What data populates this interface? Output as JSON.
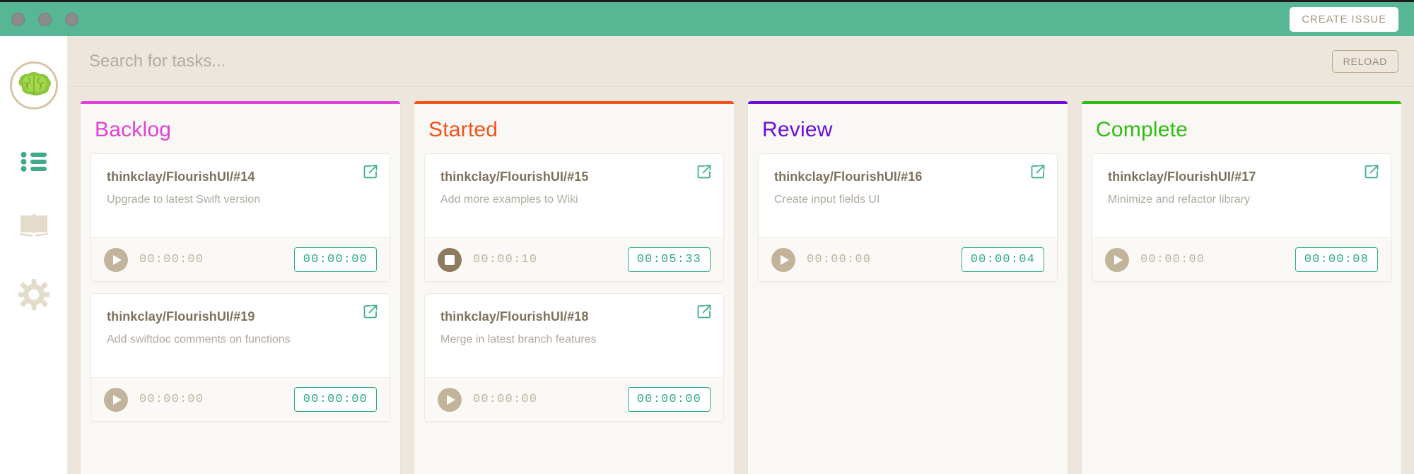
{
  "window": {
    "titlebar_color": "#57b795",
    "traffic_lights": [
      "close",
      "minimize",
      "maximize"
    ],
    "create_issue_label": "CREATE ISSUE"
  },
  "sidebar": {
    "logo_name": "brain-logo",
    "items": [
      {
        "icon": "list-icon",
        "name": "sidebar-item-tasks",
        "color": "#3fa98a"
      },
      {
        "icon": "book-icon",
        "name": "sidebar-item-docs",
        "color": "#e4dccb"
      },
      {
        "icon": "gear-icon",
        "name": "sidebar-item-settings",
        "color": "#e4dccb"
      }
    ]
  },
  "search": {
    "placeholder": "Search for tasks...",
    "value": "",
    "reload_label": "RELOAD"
  },
  "board": {
    "columns": [
      {
        "title": "Backlog",
        "accent": "#e040d8",
        "cards": [
          {
            "title": "thinkclay/FlourishUI/#14",
            "subtitle": "Upgrade to latest Swift version",
            "timer_state": "stopped",
            "elapsed": "00:00:00",
            "total": "00:00:00"
          },
          {
            "title": "thinkclay/FlourishUI/#19",
            "subtitle": "Add swiftdoc comments on functions",
            "timer_state": "stopped",
            "elapsed": "00:00:00",
            "total": "00:00:00"
          }
        ]
      },
      {
        "title": "Started",
        "accent": "#f1531a",
        "cards": [
          {
            "title": "thinkclay/FlourishUI/#15",
            "subtitle": "Add more examples to Wiki",
            "timer_state": "running",
            "elapsed": "00:00:10",
            "total": "00:05:33"
          },
          {
            "title": "thinkclay/FlourishUI/#18",
            "subtitle": "Merge in latest branch features",
            "timer_state": "stopped",
            "elapsed": "00:00:00",
            "total": "00:00:00"
          }
        ]
      },
      {
        "title": "Review",
        "accent": "#6a0ddb",
        "cards": [
          {
            "title": "thinkclay/FlourishUI/#16",
            "subtitle": "Create input fields UI",
            "timer_state": "stopped",
            "elapsed": "00:00:00",
            "total": "00:00:04"
          }
        ]
      },
      {
        "title": "Complete",
        "accent": "#2fbd12",
        "cards": [
          {
            "title": "thinkclay/FlourishUI/#17",
            "subtitle": "Minimize and refactor library",
            "timer_state": "stopped",
            "elapsed": "00:00:00",
            "total": "00:00:08"
          }
        ]
      }
    ]
  }
}
